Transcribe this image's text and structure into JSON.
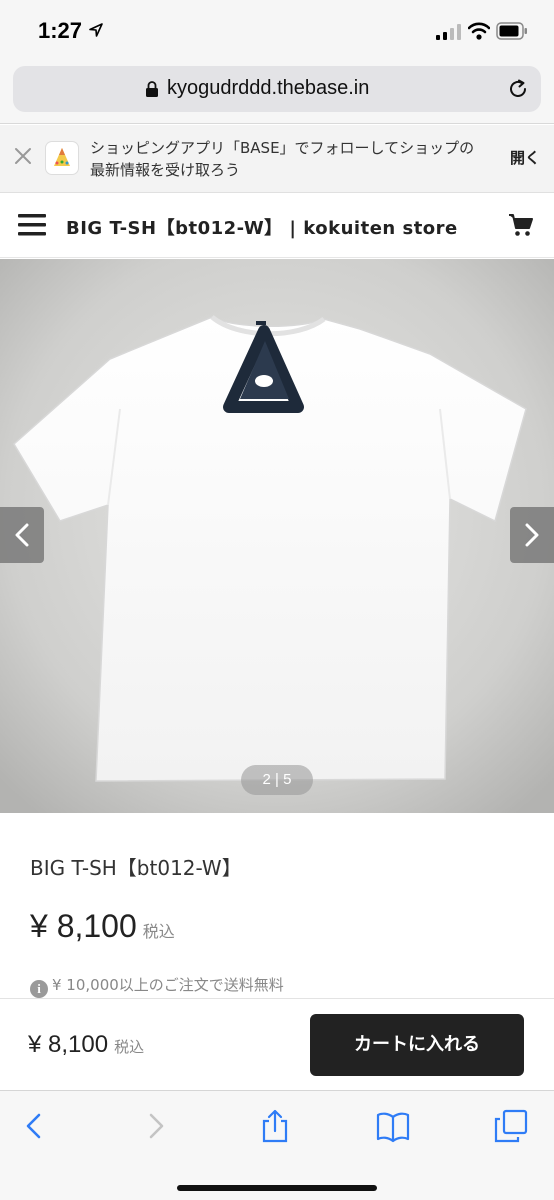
{
  "status_bar": {
    "time": "1:27"
  },
  "browser": {
    "url": "kyogudrddd.thebase.in"
  },
  "app_banner": {
    "message": "ショッピングアプリ「BASE」でフォローしてショップの最新情報を受け取ろう",
    "open_label": "開く"
  },
  "shop_header": {
    "title": "BIG T-SH【bt012-W】 | kokuiten store"
  },
  "gallery": {
    "counter": "2 | 5"
  },
  "product": {
    "name": "BIG T-SH【bt012-W】",
    "price": "¥ 8,100",
    "tax_label": "税込",
    "shipping_info": "¥ 10,000以上のご注文で送料無料"
  },
  "cart_bar": {
    "price": "¥ 8,100",
    "tax_label": "税込",
    "add_to_cart_label": "カートに入れる"
  },
  "colors": {
    "accent": "#222222",
    "ios_blue": "#2f7cf6",
    "status_bg": "#f6f6f6"
  },
  "icons": {
    "status": [
      "location-arrow-icon",
      "signal-bars-icon",
      "wifi-icon",
      "battery-icon"
    ],
    "browser": [
      "lock-icon",
      "reload-icon"
    ],
    "toolbar": [
      "back-icon",
      "forward-icon",
      "share-icon",
      "bookmarks-icon",
      "tabs-icon"
    ]
  }
}
